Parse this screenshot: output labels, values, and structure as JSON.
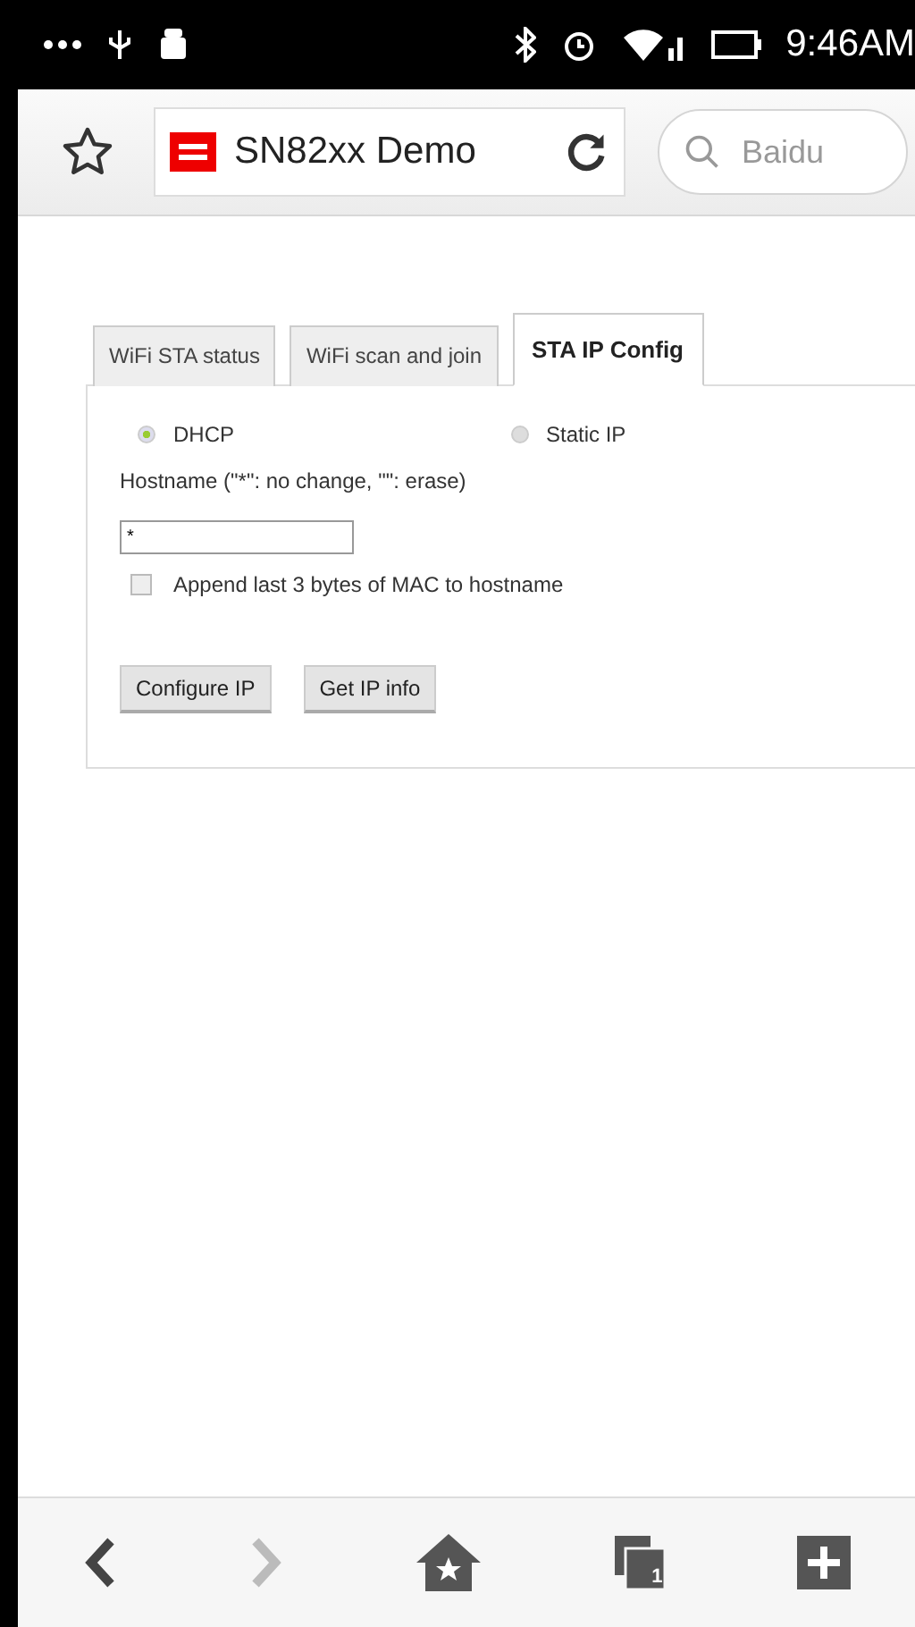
{
  "status_bar": {
    "time": "9:46AM"
  },
  "toolbar": {
    "page_title": "SN82xx Demo",
    "search": {
      "placeholder": "Baidu"
    }
  },
  "tabs": [
    {
      "label": "WiFi STA status",
      "selected": false
    },
    {
      "label": "WiFi scan and join",
      "selected": false
    },
    {
      "label": "STA IP Config",
      "selected": true
    }
  ],
  "form": {
    "modes": [
      {
        "label": "DHCP",
        "selected": true
      },
      {
        "label": "Static IP",
        "selected": false
      }
    ],
    "hostname_label": "Hostname (\"*\": no change, \"\": erase)",
    "hostname_value": "*",
    "append_mac": {
      "label": "Append last 3 bytes of MAC to hostname",
      "checked": false
    },
    "buttons": [
      "Configure IP",
      "Get IP info"
    ]
  },
  "bottom_nav": {
    "back": {
      "disabled": false
    },
    "forward": {
      "disabled": true
    },
    "tab_count": "1"
  }
}
